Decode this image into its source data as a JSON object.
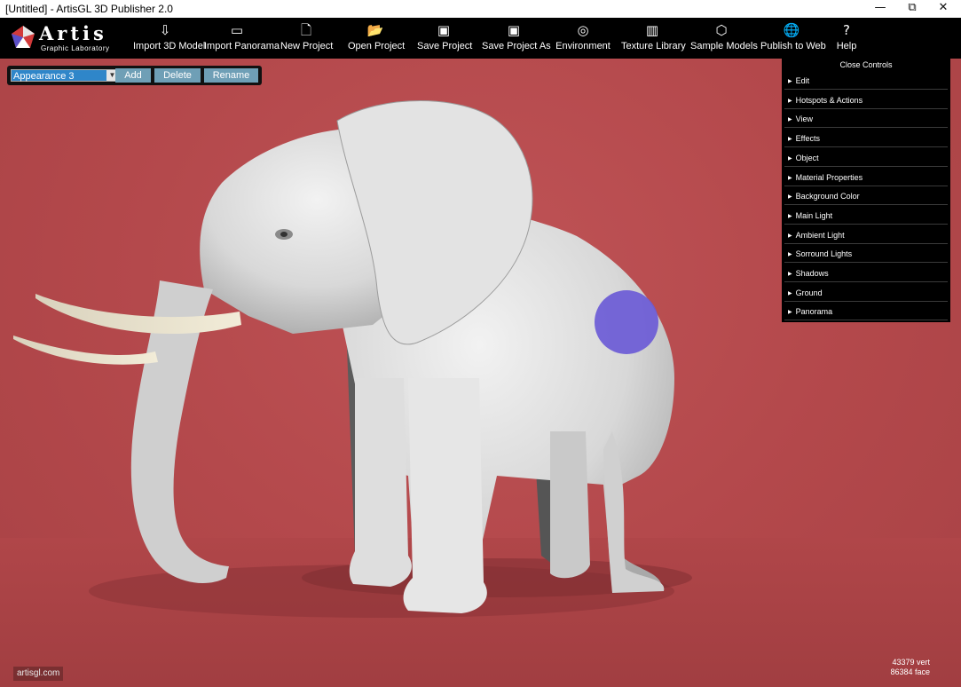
{
  "window": {
    "title": "[Untitled] - ArtisGL 3D Publisher 2.0",
    "minimize": "—",
    "restore": "⧉",
    "close": "✕"
  },
  "logo": {
    "brand": "Artis",
    "tagline": "Graphic Laboratory"
  },
  "toolbar": [
    {
      "id": "import-3d-model",
      "label": "Import 3D Model",
      "icon": "import-model-icon",
      "glyph": "⇩"
    },
    {
      "id": "import-panorama",
      "label": "Import Panorama",
      "icon": "panorama-icon",
      "glyph": "▭"
    },
    {
      "id": "new-project",
      "label": "New Project",
      "icon": "new-file-icon",
      "glyph": "🗋"
    },
    {
      "id": "open-project",
      "label": "Open Project",
      "icon": "open-folder-icon",
      "glyph": "📂"
    },
    {
      "id": "save-project",
      "label": "Save Project",
      "icon": "save-icon",
      "glyph": "▣"
    },
    {
      "id": "save-project-as",
      "label": "Save Project As",
      "icon": "save-as-icon",
      "glyph": "▣"
    },
    {
      "id": "environment",
      "label": "Environment",
      "icon": "environment-icon",
      "glyph": "◎"
    },
    {
      "id": "texture-library",
      "label": "Texture Library",
      "icon": "texture-library-icon",
      "glyph": "▥"
    },
    {
      "id": "sample-models",
      "label": "Sample Models",
      "icon": "sample-models-icon",
      "glyph": "⬡"
    },
    {
      "id": "publish-to-web",
      "label": "Publish to Web",
      "icon": "globe-icon",
      "glyph": "🌐"
    },
    {
      "id": "help",
      "label": "Help",
      "icon": "help-icon",
      "glyph": "?"
    }
  ],
  "appearance": {
    "selected": "Appearance 3",
    "add": "Add",
    "delete": "Delete",
    "rename": "Rename"
  },
  "controls": {
    "close_label": "Close Controls",
    "items": [
      "Edit",
      "Hotspots & Actions",
      "View",
      "Effects",
      "Object",
      "Material Properties",
      "Background Color",
      "Main Light",
      "Ambient Light",
      "Sorround Lights",
      "Shadows",
      "Ground",
      "Panorama"
    ]
  },
  "footer": {
    "site": "artisgl.com",
    "vertices": "43379 vert",
    "faces": "86384 face"
  },
  "colors": {
    "background": "#b5494c",
    "hotspot": "#6b5bd6",
    "toolbar": "#000000"
  }
}
